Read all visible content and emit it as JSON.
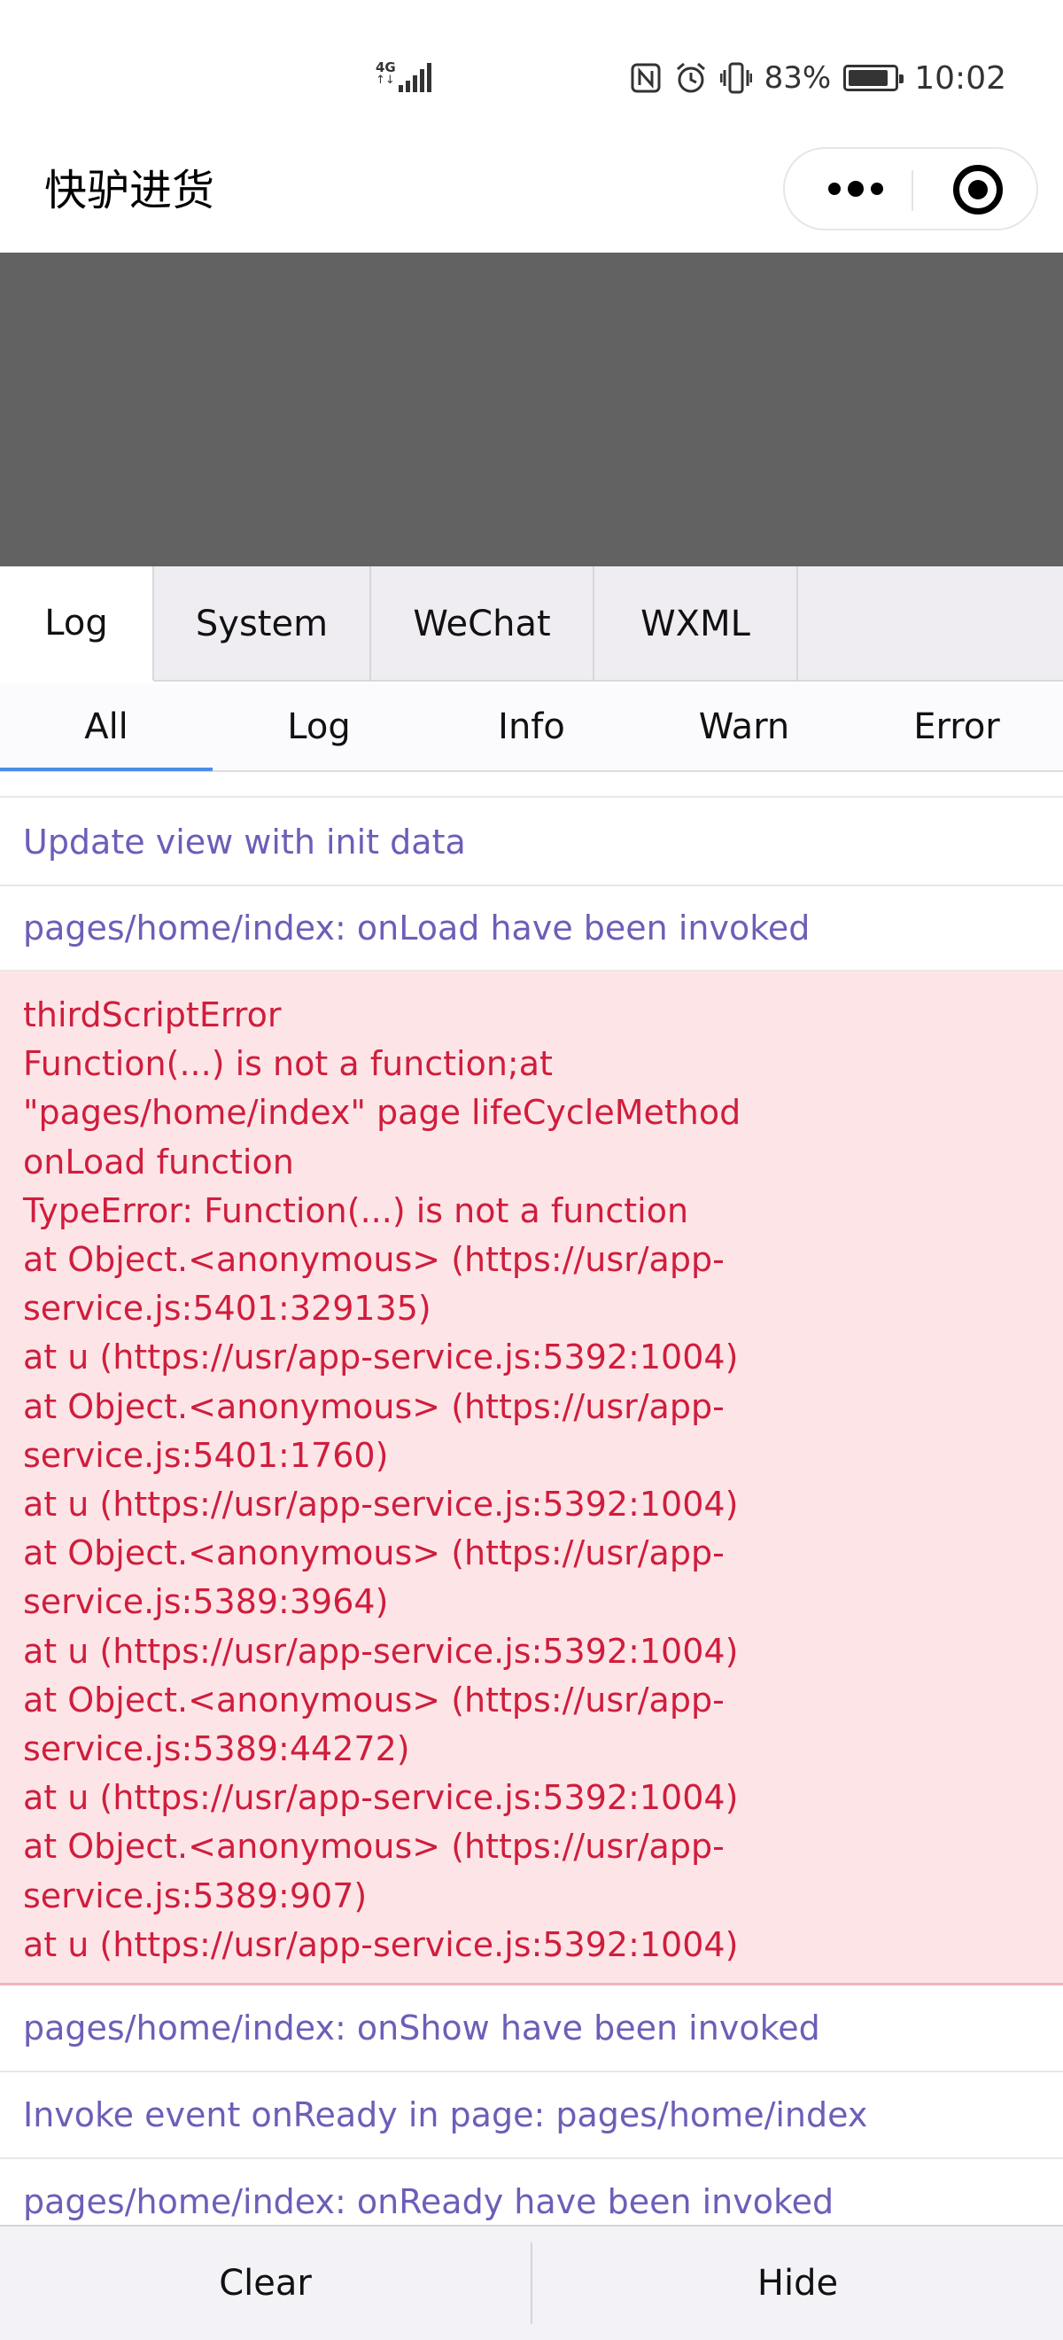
{
  "status_bar": {
    "network": "4G",
    "battery_percent": "83%",
    "time": "10:02",
    "icons": [
      "signal-icon",
      "nfc-icon",
      "alarm-icon",
      "vibrate-icon",
      "battery-icon"
    ]
  },
  "nav": {
    "title": "快驴进货",
    "more_icon": "more-dots-icon",
    "close_icon": "target-circle-icon"
  },
  "console": {
    "tabs": [
      {
        "label": "Log",
        "active": true
      },
      {
        "label": "System",
        "active": false
      },
      {
        "label": "WeChat",
        "active": false
      },
      {
        "label": "WXML",
        "active": false
      }
    ],
    "filters": [
      {
        "label": "All",
        "active": true
      },
      {
        "label": "Log",
        "active": false
      },
      {
        "label": "Info",
        "active": false
      },
      {
        "label": "Warn",
        "active": false
      },
      {
        "label": "Error",
        "active": false
      }
    ],
    "logs_before": [
      "Update view with init data",
      "pages/home/index: onLoad have been invoked"
    ],
    "error_lines": [
      "thirdScriptError",
      "Function(...) is not a function;at",
      "\"pages/home/index\" page lifeCycleMethod",
      "onLoad function",
      "TypeError: Function(...) is not a function",
      "at Object.<anonymous> (https://usr/app-",
      "service.js:5401:329135)",
      "at u (https://usr/app-service.js:5392:1004)",
      "at Object.<anonymous> (https://usr/app-",
      "service.js:5401:1760)",
      "at u (https://usr/app-service.js:5392:1004)",
      "at Object.<anonymous> (https://usr/app-",
      "service.js:5389:3964)",
      "at u (https://usr/app-service.js:5392:1004)",
      "at Object.<anonymous> (https://usr/app-",
      "service.js:5389:44272)",
      "at u (https://usr/app-service.js:5392:1004)",
      "at Object.<anonymous> (https://usr/app-",
      "service.js:5389:907)",
      "at u (https://usr/app-service.js:5392:1004)"
    ],
    "logs_after": [
      "pages/home/index: onShow have been invoked",
      "Invoke event onReady in page: pages/home/index",
      "pages/home/index: onReady have been invoked"
    ],
    "clear_label": "Clear",
    "hide_label": "Hide"
  },
  "colors": {
    "log_text": "#6b5fb8",
    "error_text": "#d01d3d",
    "error_bg": "#fde5e7",
    "accent": "#4c8de8",
    "page_gray": "#626262"
  }
}
